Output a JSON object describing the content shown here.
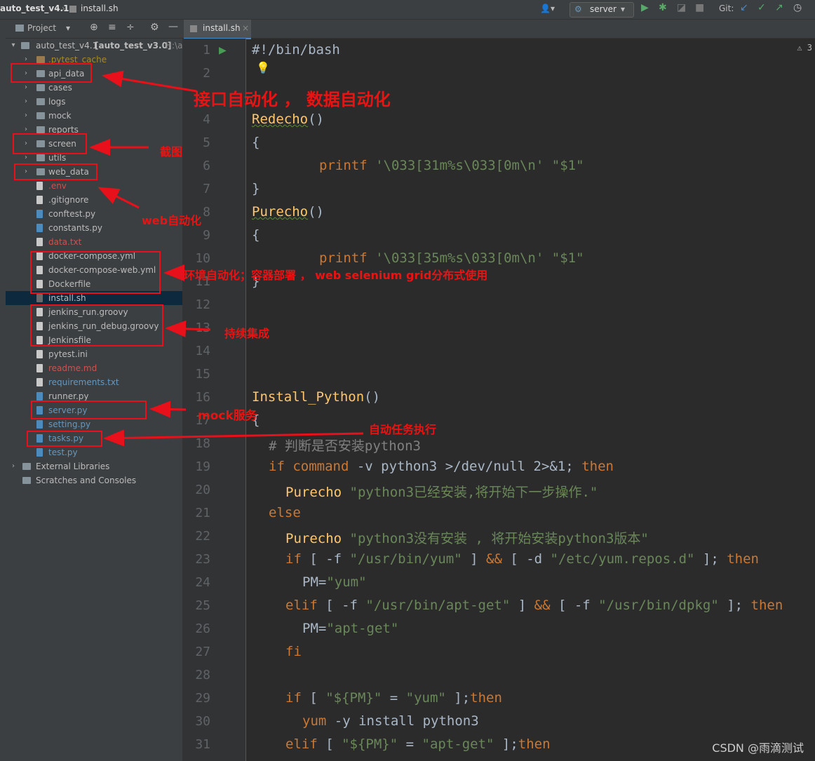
{
  "topbar": {
    "project": "auto_test_v4.1",
    "file": "install.sh",
    "run_config": "server",
    "git_label": "Git:"
  },
  "project_panel": {
    "title": "Project",
    "root": "auto_test_v4.1",
    "root_module": "[auto_test_v3.0]",
    "root_path": "H:\\a",
    "items": [
      {
        "label": ".pytest_cache",
        "kind": "folder",
        "color": "gold"
      },
      {
        "label": "api_data",
        "kind": "folder"
      },
      {
        "label": "cases",
        "kind": "folder"
      },
      {
        "label": "logs",
        "kind": "folder"
      },
      {
        "label": "mock",
        "kind": "folder"
      },
      {
        "label": "reports",
        "kind": "folder"
      },
      {
        "label": "screen",
        "kind": "folder"
      },
      {
        "label": "utils",
        "kind": "folder"
      },
      {
        "label": "web_data",
        "kind": "folder"
      },
      {
        "label": ".env",
        "kind": "file",
        "color": "red"
      },
      {
        "label": ".gitignore",
        "kind": "file"
      },
      {
        "label": "conftest.py",
        "kind": "py"
      },
      {
        "label": "constants.py",
        "kind": "py"
      },
      {
        "label": "data.txt",
        "kind": "file",
        "color": "red"
      },
      {
        "label": "docker-compose.yml",
        "kind": "file"
      },
      {
        "label": "docker-compose-web.yml",
        "kind": "file"
      },
      {
        "label": "Dockerfile",
        "kind": "file"
      },
      {
        "label": "install.sh",
        "kind": "sh",
        "selected": true
      },
      {
        "label": "jenkins_run.groovy",
        "kind": "file"
      },
      {
        "label": "jenkins_run_debug.groovy",
        "kind": "file"
      },
      {
        "label": "Jenkinsfile",
        "kind": "file"
      },
      {
        "label": "pytest.ini",
        "kind": "file"
      },
      {
        "label": "readme.md",
        "kind": "file",
        "color": "red"
      },
      {
        "label": "requirements.txt",
        "kind": "file",
        "color": "blue"
      },
      {
        "label": "runner.py",
        "kind": "py"
      },
      {
        "label": "server.py",
        "kind": "py",
        "color": "blue"
      },
      {
        "label": "setting.py",
        "kind": "py",
        "color": "blue"
      },
      {
        "label": "tasks.py",
        "kind": "py",
        "color": "blue"
      },
      {
        "label": "test.py",
        "kind": "py",
        "color": "blue"
      },
      {
        "label": "External Libraries",
        "kind": "lib"
      },
      {
        "label": "Scratches and Consoles",
        "kind": "scratch"
      }
    ]
  },
  "editor": {
    "tab": "install.sh",
    "line_numbers": [
      "1",
      "2",
      "4",
      "5",
      "6",
      "7",
      "8",
      "9",
      "10",
      "11",
      "12",
      "13",
      "14",
      "15",
      "16",
      "17",
      "18",
      "19",
      "20",
      "21",
      "22",
      "23",
      "24",
      "25",
      "26",
      "27",
      "28",
      "29",
      "30",
      "31"
    ],
    "lines": {
      "l1": "#!/bin/bash",
      "l4_fn": "Redecho",
      "l4_paren": "()",
      "brace_open": "{",
      "brace_close": "}",
      "printf": "printf",
      "red_fmt": "'\\033[31m%s\\033[0m\\n'",
      "arg1": "\"$1\"",
      "l8_fn": "Purecho",
      "l8_paren": "()",
      "purple_fmt": "'\\033[35m%s\\033[0m\\n'",
      "l16_fn": "Install_Python",
      "l16_paren": "()",
      "l18": "# 判断是否安装python3",
      "l19_if": "if",
      "l19_cmd": "command",
      "l19_rest": " -v python3 ",
      "l19_redir": ">/dev/null 2>&1",
      "l19_semi": "; ",
      "then": "then",
      "l20_fn": "Purecho",
      "l20_str": "\"python3已经安装,将开始下一步操作.\"",
      "else": "else",
      "l22_fn": "Purecho",
      "l22_str": "\"python3没有安装 , 将开始安装python3版本\"",
      "l23_if": "if",
      "l23_a": " [ -f ",
      "l23_s1": "\"/usr/bin/yum\"",
      "l23_b": " ] ",
      "and": "&&",
      "l23_c": " [ -d ",
      "l23_s2": "\"/etc/yum.repos.d\"",
      "l23_d": " ]; ",
      "l24_var": "PM=",
      "l24_str": "\"yum\"",
      "elif": "elif",
      "l25_a": " [ -f ",
      "l25_s1": "\"/usr/bin/apt-get\"",
      "l25_b": " ] ",
      "l25_c": " [ -f ",
      "l25_s2": "\"/usr/bin/dpkg\"",
      "l25_d": " ]; ",
      "l26_var": "PM=",
      "l26_str": "\"apt-get\"",
      "fi": "fi",
      "l29_if": "if",
      "l29_a": " [ ",
      "l29_s1": "\"${PM}\"",
      "l29_b": " = ",
      "l29_s2": "\"yum\"",
      "l29_c": " ];",
      "l30_cmd": "yum",
      "l30_rest": " -y install python3",
      "l31_a": " [ ",
      "l31_s1": "\"${PM}\"",
      "l31_b": " = ",
      "l31_s2": "\"apt-get\"",
      "l31_c": " ];"
    }
  },
  "annotations": {
    "api": "接口自动化 ， 数据自动化",
    "screen": "截图",
    "web": "web自动化",
    "docker": "环境自动化；容器部署 ， web selenium grid分布式使用",
    "jenkins": "持续集成",
    "mock": "mock服务",
    "tasks": "自动任务执行",
    "color": "#e8101a"
  },
  "watermark": "CSDN @雨滴测试"
}
